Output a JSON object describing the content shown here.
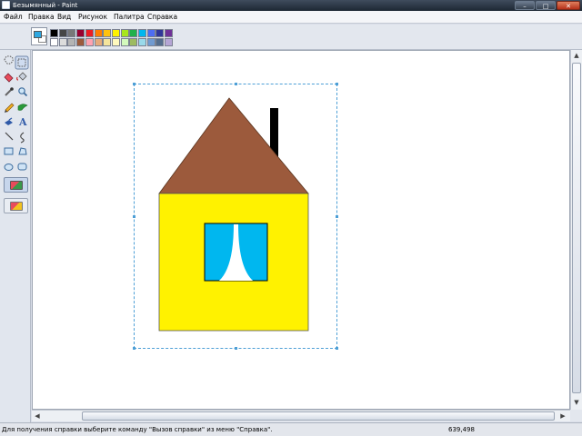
{
  "window": {
    "title": "Безымянный - Paint",
    "buttons": {
      "minimize": "–",
      "maximize": "□",
      "close": "✕"
    }
  },
  "menu": [
    "Файл",
    "Правка",
    "Вид",
    "Рисунок",
    "Палитра",
    "Справка"
  ],
  "palette": {
    "foreground": "#2ea7e0",
    "background": "#ffffff",
    "top_row": [
      "#000000",
      "#464646",
      "#787878",
      "#990030",
      "#ed1c24",
      "#ff7e00",
      "#ffc20e",
      "#fff200",
      "#a8e61d",
      "#22b14c",
      "#00b7ef",
      "#4d6df3",
      "#2f3699",
      "#6f3198"
    ],
    "bottom_row": [
      "#ffffff",
      "#dcdcdc",
      "#b4b4b4",
      "#9c5a3c",
      "#ffa3b1",
      "#e5aa7a",
      "#f5e49c",
      "#fff9bd",
      "#d3f9bc",
      "#9dbb61",
      "#99d9ea",
      "#709ad1",
      "#546d8e",
      "#b5a5d5"
    ]
  },
  "tools": [
    "free-select-icon",
    "rect-select-icon",
    "eraser-icon",
    "fill-icon",
    "color-picker-icon",
    "magnifier-icon",
    "pencil-icon",
    "brush-icon",
    "airbrush-icon",
    "text-icon",
    "line-icon",
    "curve-icon",
    "rectangle-icon",
    "polygon-icon",
    "ellipse-icon",
    "rounded-rect-icon"
  ],
  "drawing": {
    "roof_color": "#9c5a3c",
    "wall_color": "#fff200",
    "window_color": "#00b7ef",
    "curtain_color": "#ffffff",
    "chimney_color": "#000000",
    "selection_color": "#4d9fd6"
  },
  "status": {
    "message": "Для получения справки выберите команду \"Вызов справки\" из меню \"Справка\".",
    "coords": "639,498"
  }
}
